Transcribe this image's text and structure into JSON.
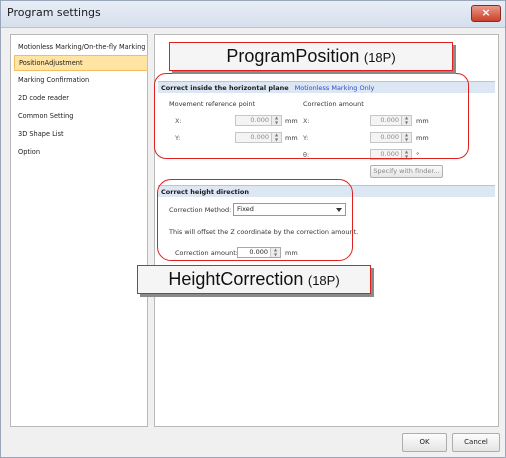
{
  "window": {
    "title": "Program settings",
    "close_label": "×"
  },
  "nav": {
    "items": [
      {
        "label": "Motionless Marking/On-the-fly Marking"
      },
      {
        "label": "PositionAdjustment"
      },
      {
        "label": "Marking Confirmation"
      },
      {
        "label": "2D code reader"
      },
      {
        "label": "Common Setting"
      },
      {
        "label": "3D Shape List"
      },
      {
        "label": "Option"
      }
    ],
    "selected_index": 1
  },
  "horizontal": {
    "title": "Correct inside the horizontal plane",
    "note": "Motionless Marking Only",
    "movement_label": "Movement reference point",
    "correction_label": "Correction amount",
    "x_label": "X:",
    "y_label": "Y:",
    "theta_label": "θ:",
    "move_x": "0.000",
    "move_y": "0.000",
    "corr_x": "0.000",
    "corr_y": "0.000",
    "corr_theta": "0.000",
    "unit_mm": "mm",
    "unit_deg": "°",
    "finder_button": "Specify with finder..."
  },
  "height": {
    "title": "Correct height direction",
    "method_label": "Correction Method:",
    "method_value": "Fixed",
    "description": "This will offset the Z coordinate by the correction amount.",
    "amount_label": "Correction amount:",
    "amount_value": "0.000",
    "unit": "mm"
  },
  "callouts": {
    "program_position": {
      "main": "ProgramPosition",
      "suffix": "(18P)"
    },
    "height_correction": {
      "main": "HeightCorrection",
      "suffix": "(18P)"
    }
  },
  "footer": {
    "ok": "OK",
    "cancel": "Cancel"
  },
  "colors": {
    "selected_item_bg": "#ffe4a3",
    "section_header_bg": "#dde6f3",
    "note_text": "#2a4fc8",
    "annotation_red": "#e02020",
    "close_button": "#c9402a"
  }
}
